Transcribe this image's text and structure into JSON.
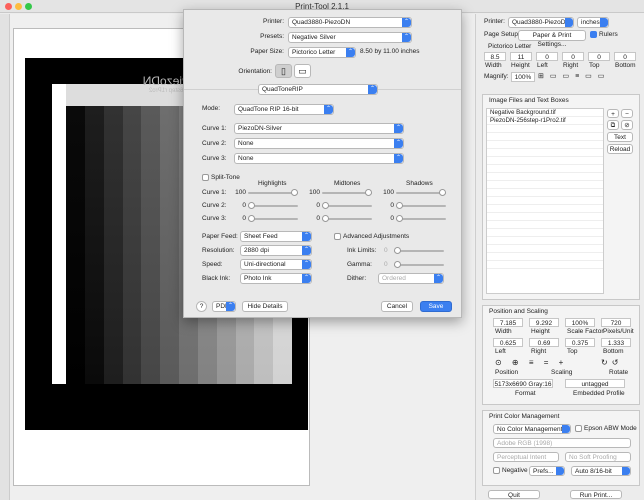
{
  "window": {
    "title": "Print-Tool 2.1.1"
  },
  "dialog": {
    "printer_label": "Printer:",
    "printer_value": "Quad3880-PiezoDN",
    "presets_label": "Presets:",
    "presets_value": "Negative Silver",
    "paper_size_label": "Paper Size:",
    "paper_size_value": "Pictorico Letter",
    "paper_size_dims": "8.50 by 11.00 inches",
    "orientation_label": "Orientation:",
    "section_value": "QuadToneRIP",
    "mode_label": "Mode:",
    "mode_value": "QuadTone RIP 16-bit",
    "curve1_label": "Curve 1:",
    "curve1_value": "PiezoDN-Silver",
    "curve2_label": "Curve 2:",
    "curve2_value": "None",
    "curve3_label": "Curve 3:",
    "curve3_value": "None",
    "split_tone_label": "Split-Tone",
    "col_highlights": "Highlights",
    "col_midtones": "Midtones",
    "col_shadows": "Shadows",
    "rows": [
      {
        "label": "Curve 1:",
        "h": "100",
        "m": "100",
        "s": "100"
      },
      {
        "label": "Curve 2:",
        "h": "0",
        "m": "0",
        "s": "0"
      },
      {
        "label": "Curve 3:",
        "h": "0",
        "m": "0",
        "s": "0"
      }
    ],
    "paper_feed_label": "Paper Feed:",
    "paper_feed_value": "Sheet Feed",
    "resolution_label": "Resolution:",
    "resolution_value": "2880 dpi",
    "speed_label": "Speed:",
    "speed_value": "Uni-directional",
    "black_ink_label": "Black Ink:",
    "black_ink_value": "Photo Ink",
    "advanced_label": "Advanced Adjustments",
    "ink_limits_label": "Ink Limits:",
    "ink_limits_value": "0",
    "gamma_label": "Gamma:",
    "gamma_value": "0",
    "dither_label": "Dither:",
    "dither_value": "Ordered",
    "help_label": "?",
    "pdf_label": "PDF",
    "hide_details_label": "Hide Details",
    "cancel_label": "Cancel",
    "save_label": "Save"
  },
  "panel": {
    "printer_label": "Printer:",
    "printer_value": "Quad3880-PiezoDN",
    "units_value": "inches",
    "page_setup_label": "Page Setup:",
    "page_setup_button": "Paper & Print Settings...",
    "rulers_label": "Rulers",
    "paper_name": "Pictorico Letter",
    "dims": [
      {
        "value": "8.5",
        "label": "Width"
      },
      {
        "value": "11",
        "label": "Height"
      },
      {
        "value": "0",
        "label": "Left"
      },
      {
        "value": "0",
        "label": "Right"
      },
      {
        "value": "0",
        "label": "Top"
      },
      {
        "value": "0",
        "label": "Bottom"
      }
    ],
    "magnify_label": "Magnify:",
    "magnify_value": "100%",
    "files_header": "Image Files and Text Boxes",
    "files": [
      "Negative Background.tif",
      "PiezoDN-256step-r1Pro2.tif"
    ],
    "text_button": "Text",
    "reload_button": "Reload",
    "pos_header": "Position and Scaling",
    "pos_row1": [
      {
        "value": "7.185",
        "label": "Width"
      },
      {
        "value": "9.292",
        "label": "Height"
      },
      {
        "value": "100%",
        "label": "Scale Factor"
      },
      {
        "value": "720",
        "label": "Pixels/Unit"
      }
    ],
    "pos_row2": [
      {
        "value": "0.625",
        "label": "Left"
      },
      {
        "value": "0.69",
        "label": "Right"
      },
      {
        "value": "0.375",
        "label": "Top"
      },
      {
        "value": "1.333",
        "label": "Bottom"
      }
    ],
    "position_label": "Position",
    "scaling_label": "Scaling",
    "rotate_label": "Rotate",
    "format_value": "5173x6690 Gray:16",
    "format_label": "Format",
    "profile_value": "untagged",
    "profile_label": "Embedded Profile",
    "color_header": "Print Color Management",
    "color_mgmt_value": "No Color Management",
    "abw_label": "Epson ABW Mode",
    "profile_select": "Adobe RGB (1998)",
    "intent_select": "Perceptual Intent",
    "softproof_select": "No Soft Proofing",
    "negative_label": "Negative",
    "prefs_value": "Prefs...",
    "bit_value": "Auto 8/16-bit",
    "quit_label": "Quit",
    "run_print_label": "Run Print..."
  },
  "image": {
    "mirrored_text": "PiezoDN",
    "mirrored_sub": "256step r1Pro2"
  }
}
